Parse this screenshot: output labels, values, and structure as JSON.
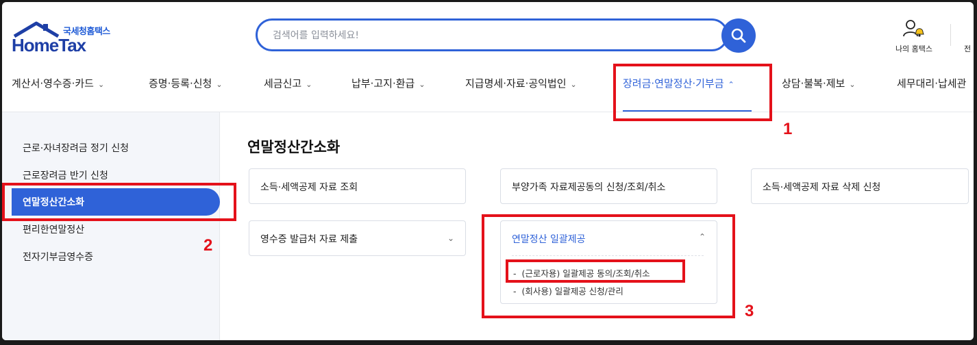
{
  "header": {
    "logo_kr": "국세청홈택스",
    "logo_en": "HomeTax",
    "search_placeholder": "검색어를 입력하세요!",
    "my_hometax": "나의 홈택스",
    "cut_label": "전"
  },
  "nav": {
    "items": [
      {
        "label": "계산서·영수증·카드"
      },
      {
        "label": "증명·등록·신청"
      },
      {
        "label": "세금신고"
      },
      {
        "label": "납부·고지·환급"
      },
      {
        "label": "지급명세·자료·공익법인"
      },
      {
        "label": "장려금·연말정산·기부금",
        "active": true
      },
      {
        "label": "상담·불복·제보"
      },
      {
        "label": "세무대리·납세관"
      }
    ]
  },
  "sidebar": {
    "items": [
      {
        "label": "근로·자녀장려금 정기 신청"
      },
      {
        "label": "근로장려금 반기 신청"
      },
      {
        "label": "연말정산간소화",
        "active": true
      },
      {
        "label": "편리한연말정산"
      },
      {
        "label": "전자기부금영수증"
      }
    ]
  },
  "main": {
    "title": "연말정산간소화",
    "cards": [
      {
        "label": "소득·세액공제 자료 조회"
      },
      {
        "label": "부양가족 자료제공동의 신청/조회/취소"
      },
      {
        "label": "소득·세액공제 자료 삭제 신청"
      },
      {
        "label": "영수증 발급처 자료 제출"
      },
      {
        "label": "연말정산 일괄제공"
      }
    ],
    "sub_items": [
      {
        "label": "(근로자용) 일괄제공 동의/조회/취소"
      },
      {
        "label": "(회사용) 일괄제공 신청/관리"
      }
    ]
  },
  "annotations": [
    "1",
    "2",
    "3"
  ],
  "colors": {
    "accent": "#2f62d8",
    "highlight": "#e4111a",
    "brand": "#1e3fa6"
  },
  "icons": [
    "home-roof-icon",
    "search-icon",
    "user-bell-icon",
    "chevron-down-icon",
    "chevron-up-icon"
  ]
}
